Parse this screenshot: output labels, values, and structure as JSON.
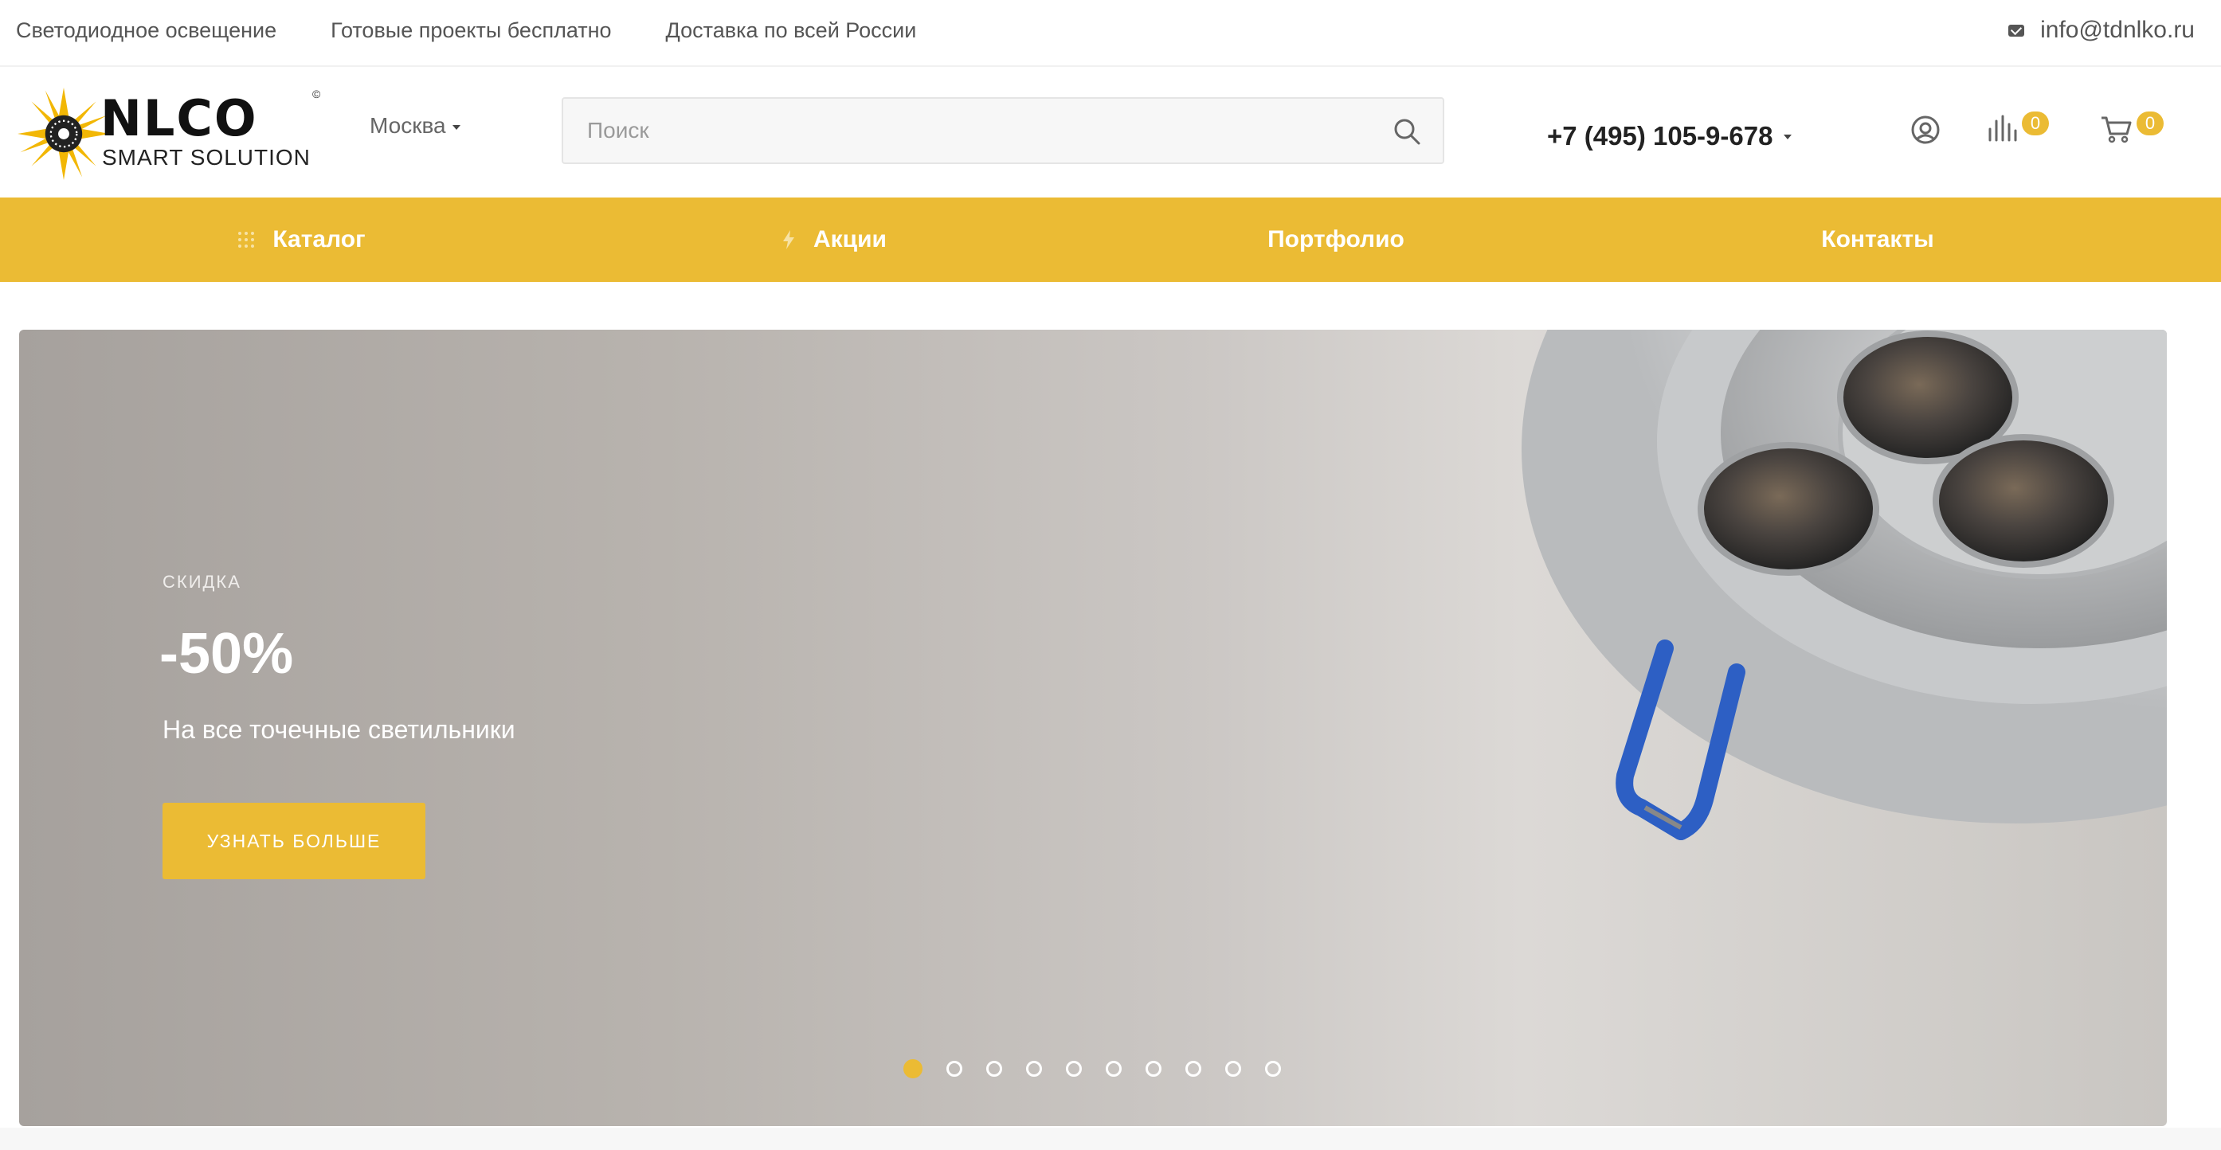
{
  "topbar": {
    "links": [
      "Светодиодное освещение",
      "Готовые проекты бесплатно",
      "Доставка по всей России"
    ],
    "email": "info@tdnlko.ru"
  },
  "header": {
    "logo": {
      "brand": "NLCO",
      "sub": "SMART SOLUTION",
      "mark": "©"
    },
    "city": "Москва",
    "search": {
      "placeholder": "Поиск",
      "value": ""
    },
    "phone": "+7 (495) 105-9-678",
    "compare_count": "0",
    "cart_count": "0"
  },
  "nav": {
    "items": [
      {
        "label": "Каталог",
        "icon": "grid-icon"
      },
      {
        "label": "Акции",
        "icon": "lightning-icon"
      },
      {
        "label": "Портфолио",
        "icon": ""
      },
      {
        "label": "Контакты",
        "icon": ""
      }
    ]
  },
  "hero": {
    "kicker": "СКИДКА",
    "headline": "-50%",
    "description": "На все точечные светильники",
    "cta": "УЗНАТЬ БОЛЬШЕ",
    "slides_total": 10,
    "active_slide": 1
  },
  "colors": {
    "accent": "#ebbb34",
    "text": "#333333"
  }
}
